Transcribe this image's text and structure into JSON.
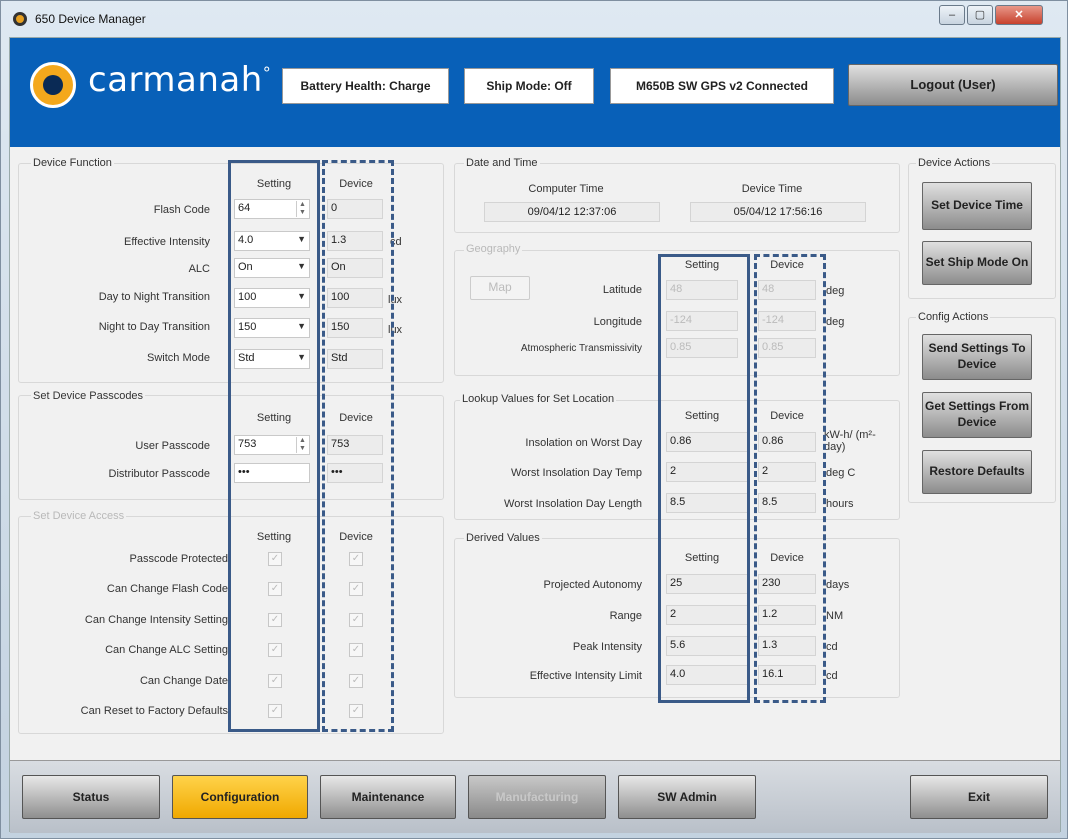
{
  "window": {
    "title": "650 Device Manager",
    "min": "–",
    "max": "▢",
    "close": "✕"
  },
  "header": {
    "logo_text": "carmanah",
    "logo_mark": "°",
    "battery": "Battery Health: Charge",
    "ship_mode": "Ship Mode: Off",
    "connection": "M650B SW GPS v2 Connected",
    "logout": "Logout (User)"
  },
  "device_function": {
    "title": "Device Function",
    "setting_header": "Setting",
    "device_header": "Device",
    "rows": [
      {
        "label": "Flash Code",
        "setting": "64",
        "device": "0",
        "unit": "",
        "control": "spin"
      },
      {
        "label": "Effective Intensity",
        "setting": "4.0",
        "device": "1.3",
        "unit": "cd",
        "control": "dropdown"
      },
      {
        "label": "ALC",
        "setting": "On",
        "device": "On",
        "unit": "",
        "control": "dropdown"
      },
      {
        "label": "Day to Night Transition",
        "setting": "100",
        "device": "100",
        "unit": "lux",
        "control": "dropdown"
      },
      {
        "label": "Night to Day Transition",
        "setting": "150",
        "device": "150",
        "unit": "lux",
        "control": "dropdown"
      },
      {
        "label": "Switch Mode",
        "setting": "Std",
        "device": "Std",
        "unit": "",
        "control": "dropdown"
      }
    ]
  },
  "passcodes": {
    "title": "Set Device Passcodes",
    "setting_header": "Setting",
    "device_header": "Device",
    "rows": [
      {
        "label": "User Passcode",
        "setting": "753",
        "device": "753"
      },
      {
        "label": "Distributor Passcode",
        "setting": "•••",
        "device": "•••"
      }
    ]
  },
  "access": {
    "title": "Set Device Access",
    "setting_header": "Setting",
    "device_header": "Device",
    "rows": [
      {
        "label": "Passcode Protected"
      },
      {
        "label": "Can Change Flash Code"
      },
      {
        "label": "Can Change Intensity Setting"
      },
      {
        "label": "Can Change ALC Setting"
      },
      {
        "label": "Can Change Date"
      },
      {
        "label": "Can Reset to Factory Defaults"
      }
    ],
    "check": "✓"
  },
  "datetime": {
    "title": "Date and Time",
    "computer_label": "Computer Time",
    "device_label": "Device Time",
    "computer_value": "09/04/12 12:37:06",
    "device_value": "05/04/12 17:56:16"
  },
  "geography": {
    "title": "Geography",
    "map_button": "Map",
    "setting_header": "Setting",
    "device_header": "Device",
    "rows": [
      {
        "label": "Latitude",
        "setting": "48",
        "device": "48",
        "unit": "deg"
      },
      {
        "label": "Longitude",
        "setting": "-124",
        "device": "-124",
        "unit": "deg"
      },
      {
        "label": "Atmospheric Transmissivity",
        "setting": "0.85",
        "device": "0.85",
        "unit": ""
      }
    ]
  },
  "lookup": {
    "title": "Lookup Values for Set Location",
    "setting_header": "Setting",
    "device_header": "Device",
    "rows": [
      {
        "label": "Insolation on Worst Day",
        "setting": "0.86",
        "device": "0.86",
        "unit": "kW-h/ (m²-day)"
      },
      {
        "label": "Worst Insolation Day Temp",
        "setting": "2",
        "device": "2",
        "unit": "deg C"
      },
      {
        "label": "Worst Insolation Day Length",
        "setting": "8.5",
        "device": "8.5",
        "unit": "hours"
      }
    ]
  },
  "derived": {
    "title": "Derived Values",
    "setting_header": "Setting",
    "device_header": "Device",
    "rows": [
      {
        "label": "Projected Autonomy",
        "setting": "25",
        "device": "230",
        "unit": "days"
      },
      {
        "label": "Range",
        "setting": "2",
        "device": "1.2",
        "unit": "NM"
      },
      {
        "label": "Peak Intensity",
        "setting": "5.6",
        "device": "1.3",
        "unit": "cd"
      },
      {
        "label": "Effective Intensity Limit",
        "setting": "4.0",
        "device": "16.1",
        "unit": "cd"
      }
    ]
  },
  "device_actions": {
    "title": "Device Actions",
    "set_time": "Set Device Time",
    "ship_mode": "Set Ship Mode On"
  },
  "config_actions": {
    "title": "Config Actions",
    "send": "Send Settings To Device",
    "get": "Get Settings From Device",
    "restore": "Restore Defaults"
  },
  "nav": {
    "status": "Status",
    "configuration": "Configuration",
    "maintenance": "Maintenance",
    "manufacturing": "Manufacturing",
    "sw_admin": "SW Admin",
    "exit": "Exit"
  },
  "colors": {
    "header_blue": "#0860b8",
    "active_tab": "#f0a800",
    "highlight_box": "#3a5a88"
  }
}
